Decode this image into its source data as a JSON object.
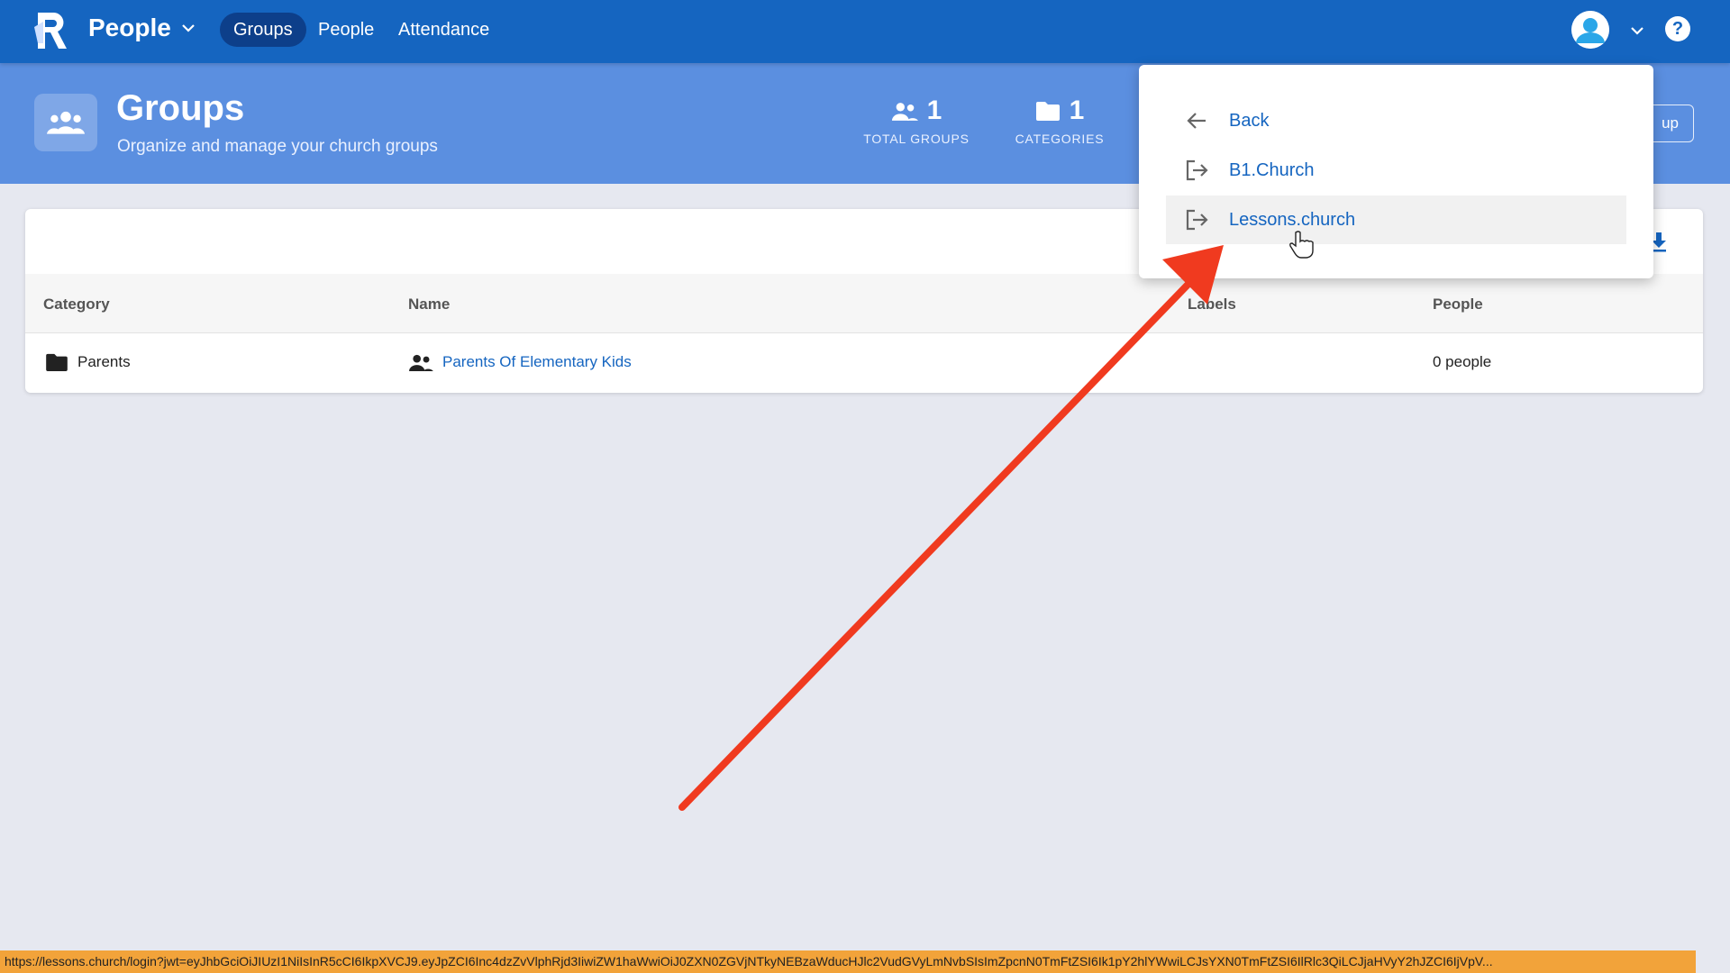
{
  "nav": {
    "app_name": "People",
    "tabs": [
      {
        "label": "Groups",
        "active": true
      },
      {
        "label": "People",
        "active": false
      },
      {
        "label": "Attendance",
        "active": false
      }
    ],
    "help": "?"
  },
  "header": {
    "title": "Groups",
    "subtitle": "Organize and manage your church groups",
    "stats": [
      {
        "value": "1",
        "label": "TOTAL GROUPS",
        "icon": "groups-icon"
      },
      {
        "value": "1",
        "label": "CATEGORIES",
        "icon": "folder-icon"
      }
    ],
    "button_partial": "up"
  },
  "table": {
    "columns": [
      "Category",
      "Name",
      "Labels",
      "People"
    ],
    "rows": [
      {
        "category": "Parents",
        "name": "Parents Of Elementary Kids",
        "labels": "",
        "people": "0 people"
      }
    ]
  },
  "menu": {
    "items": [
      {
        "label": "Back",
        "icon": "arrow-left-icon"
      },
      {
        "label": "B1.Church",
        "icon": "logout-icon"
      },
      {
        "label": "Lessons.church",
        "icon": "logout-icon",
        "hovered": true
      }
    ]
  },
  "status_url": "https://lessons.church/login?jwt=eyJhbGciOiJIUzI1NiIsInR5cCI6IkpXVCJ9.eyJpZCI6Inc4dzZvVlphRjd3IiwiZW1haWwiOiJ0ZXN0ZGVjNTkyNEBzaWducHJlc2VudGVyLmNvbSIsImZpcnN0TmFtZSI6Ik1pY2hlYWwiLCJsYXN0TmFtZSI6IlRlc3QiLCJjaHVyY2hJZCI6IjVpV...",
  "colors": {
    "nav": "#1565c0",
    "header": "#5b8fe0",
    "arrow": "#f03a1f",
    "status": "#f2a33a"
  }
}
